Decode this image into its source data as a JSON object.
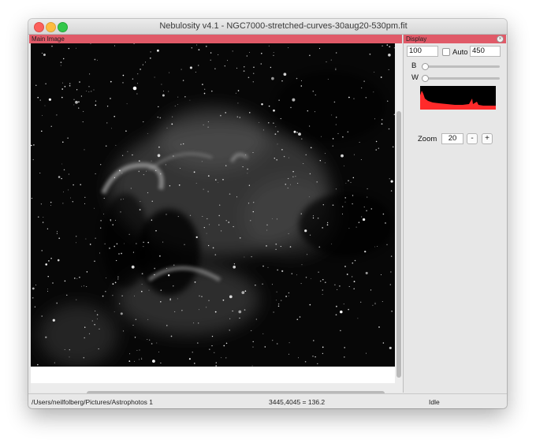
{
  "window": {
    "title": "Nebulosity v4.1 - NGC7000-stretched-curves-30aug20-530pm.fit"
  },
  "main_pane": {
    "header": "Main Image"
  },
  "display_panel": {
    "header": "Display",
    "low_value": "100",
    "high_value": "450",
    "auto_label": "Auto",
    "auto_checked": false,
    "b_label": "B",
    "w_label": "W",
    "zoom_label": "Zoom",
    "zoom_value": "20",
    "zoom_out_label": "-",
    "zoom_in_label": "+"
  },
  "status": {
    "path": "/Users/neilfolberg/Pictures/Astrophotos 1",
    "coords": "3445,4045 = 136.2",
    "state": "Idle"
  },
  "colors": {
    "pane_header": "#e05a68",
    "histogram": "#ff2a2a"
  }
}
